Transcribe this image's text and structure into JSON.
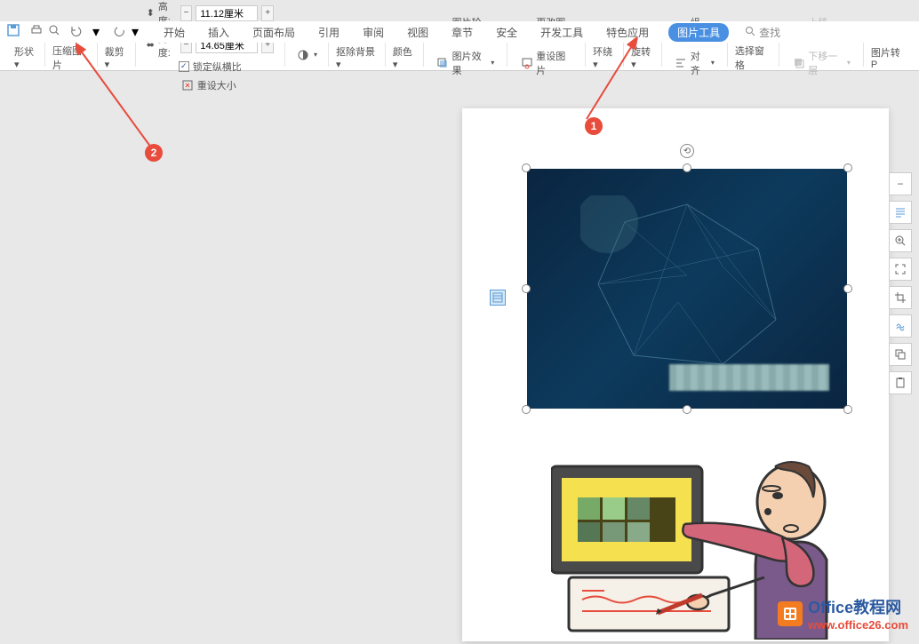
{
  "quickAccess": {
    "icons": [
      "save-icon",
      "print-icon",
      "print-preview-icon",
      "undo-icon",
      "redo-icon"
    ]
  },
  "tabs": {
    "items": [
      {
        "label": "开始",
        "name": "tab-home"
      },
      {
        "label": "插入",
        "name": "tab-insert"
      },
      {
        "label": "页面布局",
        "name": "tab-page-layout"
      },
      {
        "label": "引用",
        "name": "tab-references"
      },
      {
        "label": "审阅",
        "name": "tab-review"
      },
      {
        "label": "视图",
        "name": "tab-view"
      },
      {
        "label": "章节",
        "name": "tab-chapter"
      },
      {
        "label": "安全",
        "name": "tab-security"
      },
      {
        "label": "开发工具",
        "name": "tab-developer"
      },
      {
        "label": "特色应用",
        "name": "tab-special"
      },
      {
        "label": "图片工具",
        "name": "tab-picture-tools",
        "active": true
      }
    ],
    "searchLabel": "查找"
  },
  "ribbon": {
    "shape": "形状",
    "compress": "压缩图片",
    "crop": "裁剪",
    "heightLabel": "高度:",
    "heightValue": "11.12厘米",
    "widthLabel": "宽度:",
    "widthValue": "14.65厘米",
    "lockAspect": "锁定纵横比",
    "resetSize": "重设大小",
    "removeBg": "抠除背景",
    "color": "颜色",
    "outline": "图片轮廓",
    "effects": "图片效果",
    "changePicture": "更改图片",
    "resetPicture": "重设图片",
    "wrap": "环绕",
    "rotate": "旋转",
    "group": "组合",
    "align": "对齐",
    "selectPane": "选择窗格",
    "bringForward": "上移一层",
    "sendBackward": "下移一层",
    "convertPdf": "图片转P"
  },
  "annotations": {
    "circle1": "1",
    "circle2": "2"
  },
  "watermark": {
    "text1": "Office教程网",
    "text2": "www.office26.com"
  }
}
